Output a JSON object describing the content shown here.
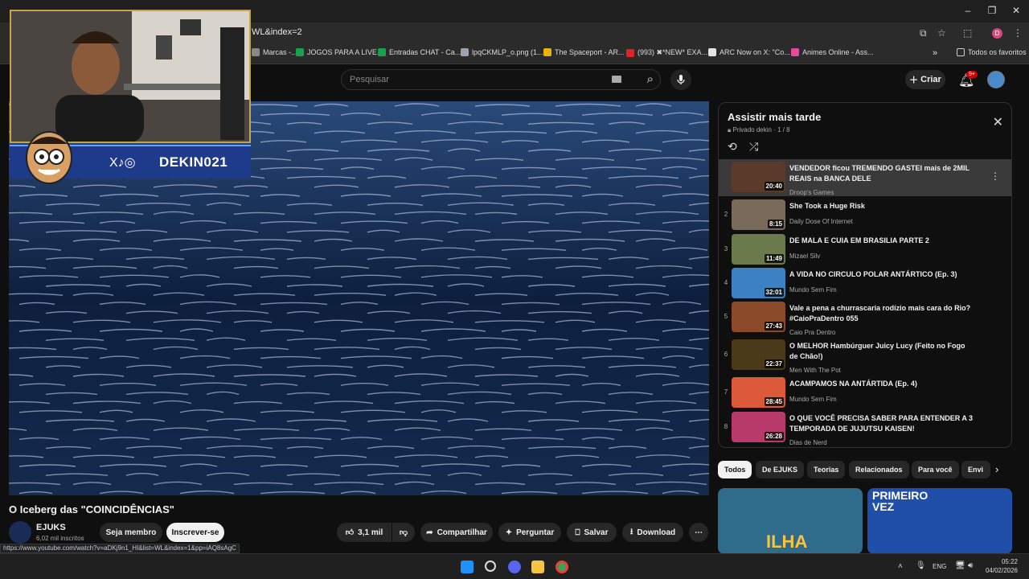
{
  "browser": {
    "url": "WL&index=2",
    "bookmarks": [
      {
        "label": "Marcas -...",
        "color": "#888888"
      },
      {
        "label": "JOGOS PARA A LIVE...",
        "color": "#16a34a"
      },
      {
        "label": "Entradas CHAT - Ca...",
        "color": "#16a34a"
      },
      {
        "label": "lpqCKMLP_o.png (1...",
        "color": "#9ca3af"
      },
      {
        "label": "The Spaceport - AR...",
        "color": "#eab308"
      },
      {
        "label": "(993) ✖*NEW* EXA...",
        "color": "#dc2626"
      },
      {
        "label": "ARC Now on X: \"Co...",
        "color": "#e5e5e5"
      },
      {
        "label": "Animes Online - Ass...",
        "color": "#ec4899"
      }
    ],
    "bookmarks_folder": "Todos os favoritos",
    "profile_initial": "D"
  },
  "youtube": {
    "search_placeholder": "Pesquisar",
    "create_label": "Criar",
    "notif_badge": "9+"
  },
  "webcam": {
    "handle": "DEKIN021",
    "social": "X♪◎"
  },
  "video": {
    "title": "O Iceberg das \"COINCIDÊNCIAS\"",
    "channel": "EJUKS",
    "subscribers": "6,02 mil inscritos",
    "member_label": "Seja membro",
    "subscribe_label": "Inscrever-se",
    "likes": "3,1 mil",
    "share_label": "Compartilhar",
    "ask_label": "Perguntar",
    "save_label": "Salvar",
    "download_label": "Download",
    "status_url": "https://www.youtube.com/watch?v=aDKj9n1_HI&list=WL&index=1&pp=iAQ8sAgC"
  },
  "playlist": {
    "title": "Assistir mais tarde",
    "subtitle": "Privado dekin · 1 / 8",
    "items": [
      {
        "idx": "",
        "title": "VENDEDOR ficou TREMENDO GASTEI mais de 2MIL REAIS na BANCA DELE",
        "channel": "Droop's Games",
        "duration": "20:40",
        "color": "#5b3a29"
      },
      {
        "idx": "2",
        "title": "She Took a Huge Risk",
        "channel": "Daily Dose Of Internet",
        "duration": "8:15",
        "color": "#7a6a5a"
      },
      {
        "idx": "3",
        "title": "DE MALA E CUIA EM BRASILIA PARTE 2",
        "channel": "Mizael Silv",
        "duration": "11:49",
        "color": "#6b7a4a"
      },
      {
        "idx": "4",
        "title": "A VIDA NO CIRCULO POLAR ANTÁRTICO (Ep. 3)",
        "channel": "Mundo Sem Fim",
        "duration": "32:01",
        "color": "#3b82c4"
      },
      {
        "idx": "5",
        "title": "Vale a pena a churrascaria rodízio mais cara do Rio? #CaioPraDentro 055",
        "channel": "Caio Pra Dentro",
        "duration": "27:43",
        "color": "#8a4a2a"
      },
      {
        "idx": "6",
        "title": "O MELHOR Hambúrguer Juicy Lucy (Feito no Fogo de Chão!)",
        "channel": "Men With The Pot",
        "duration": "22:37",
        "color": "#4a3a1a"
      },
      {
        "idx": "7",
        "title": "ACAMPAMOS NA ANTÁRTIDA (Ep. 4)",
        "channel": "Mundo Sem Fim",
        "duration": "28:45",
        "color": "#dc5a3a"
      },
      {
        "idx": "8",
        "title": "O QUE VOCÊ PRECISA SABER PARA ENTENDER A 3 TEMPORADA DE JUJUTSU KAISEN!",
        "channel": "Dias de Nerd",
        "duration": "26:28",
        "color": "#b83a6a"
      }
    ]
  },
  "chips": [
    "Todos",
    "De EJUKS",
    "Teorias",
    "Relacionados",
    "Para você",
    "Envi"
  ],
  "recommendations": [
    {
      "caption": "ILHA",
      "color": "#2f6b8a"
    },
    {
      "caption": "PRIMEIRO VEZ",
      "color": "#1f4fa8"
    }
  ],
  "taskbar": {
    "lang": "ENG",
    "time": "05:22",
    "date": "04/02/2026"
  }
}
